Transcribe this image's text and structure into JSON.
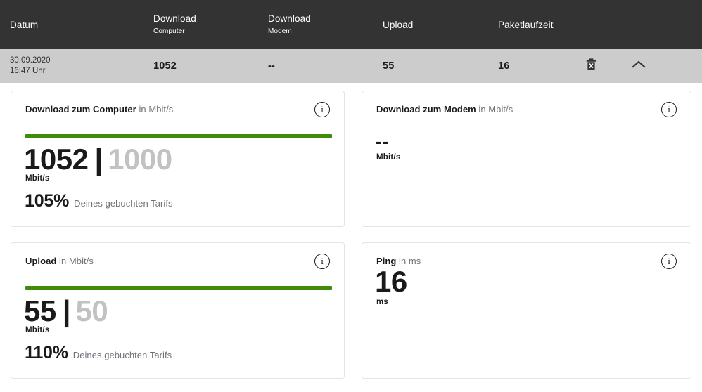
{
  "table": {
    "columns": [
      {
        "label": "Datum",
        "sub": ""
      },
      {
        "label": "Download",
        "sub": "Computer"
      },
      {
        "label": "Download",
        "sub": "Modem"
      },
      {
        "label": "Upload",
        "sub": ""
      },
      {
        "label": "Paketlaufzeit",
        "sub": ""
      }
    ],
    "row": {
      "date": "30.09.2020",
      "time": "16:47 Uhr",
      "download_computer": "1052",
      "download_modem": "--",
      "upload": "55",
      "paketlaufzeit": "16",
      "delete_icon": "trash-icon",
      "collapse_icon": "chevron-up-icon"
    }
  },
  "cards": [
    {
      "title": "Download zum Computer",
      "title_suffix": "in Mbit/s",
      "info_icon": "info-icon",
      "has_bar": true,
      "value": "1052",
      "separator": "|",
      "reference": "1000",
      "unit": "Mbit/s",
      "percent": "105%",
      "percent_label": "Deines gebuchten Tarifs"
    },
    {
      "title": "Download zum Modem",
      "title_suffix": "in Mbit/s",
      "info_icon": "info-icon",
      "has_bar": false,
      "value": "--",
      "unit": "Mbit/s"
    },
    {
      "title": "Upload",
      "title_suffix": "in Mbit/s",
      "info_icon": "info-icon",
      "has_bar": true,
      "value": "55",
      "separator": "|",
      "reference": "50",
      "unit": "Mbit/s",
      "percent": "110%",
      "percent_label": "Deines gebuchten Tarifs"
    },
    {
      "title": "Ping",
      "title_suffix": "in ms",
      "info_icon": "info-icon",
      "has_bar": false,
      "value": "16",
      "unit": "ms"
    }
  ],
  "colors": {
    "header_bg": "#333333",
    "row_bg": "#cccccc",
    "bar_green": "#3e8c0a",
    "reference_gray": "#c2c2c2",
    "muted_text": "#6f7379"
  }
}
